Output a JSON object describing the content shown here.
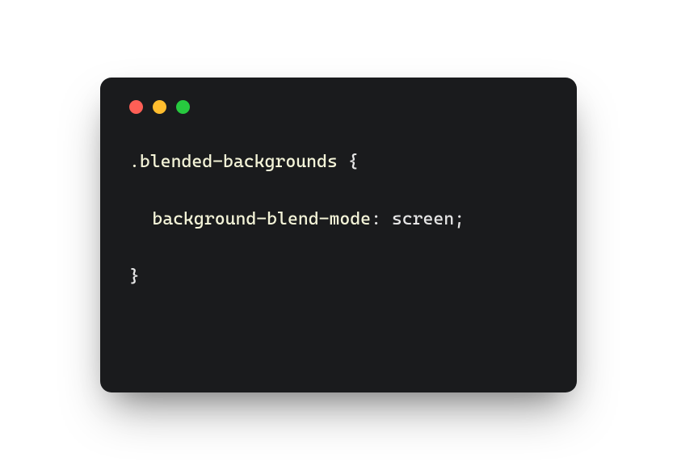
{
  "code": {
    "selector": ".blended-backgrounds",
    "openBrace": " {",
    "property": "background-blend-mode",
    "colon": ": ",
    "value": "screen",
    "semicolon": ";",
    "closeBrace": "}"
  }
}
